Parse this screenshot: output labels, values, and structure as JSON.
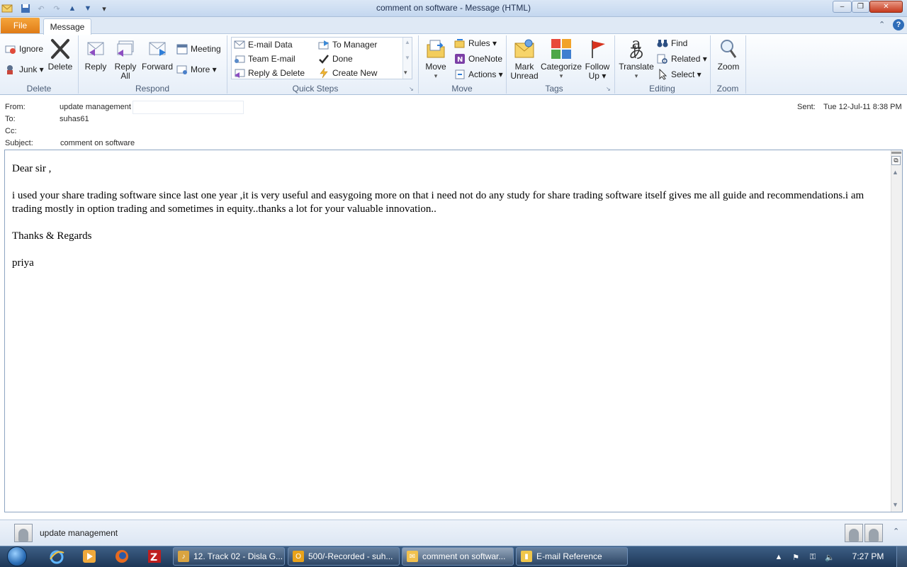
{
  "window": {
    "title": "comment on software - Message (HTML)",
    "controls": {
      "minimize": "–",
      "restore": "❐",
      "close": "✕"
    }
  },
  "quick_access": {
    "icons": [
      "outlook-icon",
      "save-icon",
      "undo-icon",
      "redo-icon",
      "previous-item-icon",
      "next-item-icon",
      "customize-icon"
    ]
  },
  "tabs": {
    "file": "File",
    "message": "Message"
  },
  "ribbon": {
    "delete_group": {
      "label": "Delete",
      "ignore": "Ignore",
      "junk": "Junk ▾",
      "delete": "Delete"
    },
    "respond_group": {
      "label": "Respond",
      "reply": "Reply",
      "reply_all_1": "Reply",
      "reply_all_2": "All",
      "forward": "Forward",
      "meeting": "Meeting",
      "more": "More ▾"
    },
    "quick_steps": {
      "label": "Quick Steps",
      "items": [
        "E-mail Data",
        "To Manager",
        "Team E-mail",
        "Done",
        "Reply & Delete",
        "Create New"
      ]
    },
    "move_group": {
      "label": "Move",
      "move": "Move",
      "rules": "Rules ▾",
      "onenote": "OneNote",
      "actions": "Actions ▾"
    },
    "tags_group": {
      "label": "Tags",
      "mark_unread_1": "Mark",
      "mark_unread_2": "Unread",
      "categorize": "Categorize",
      "follow_up_1": "Follow",
      "follow_up_2": "Up ▾"
    },
    "editing_group": {
      "label": "Editing",
      "translate": "Translate",
      "find": "Find",
      "related": "Related ▾",
      "select": "Select ▾"
    },
    "zoom_group": {
      "label": "Zoom",
      "zoom": "Zoom"
    }
  },
  "header": {
    "from_label": "From:",
    "from_value": "update management",
    "to_label": "To:",
    "to_value": "suhas61",
    "cc_label": "Cc:",
    "cc_value": "",
    "subject_label": "Subject:",
    "subject_value": "comment on software",
    "sent_label": "Sent:",
    "sent_value": "Tue 12-Jul-11 8:38 PM"
  },
  "message_body": {
    "greeting": "Dear sir ,",
    "paragraph": "i used your share trading software since last one year ,it is very useful and easygoing more on that i need not do any study for share trading software itself gives me all guide and recommendations.i am trading mostly in option trading and sometimes in equity..thanks a lot for your valuable innovation..",
    "closing": "Thanks & Regards",
    "signature": "priya"
  },
  "people_pane": {
    "name": "update management"
  },
  "taskbar": {
    "tasks": [
      {
        "label": "12. Track 02 - Disla G...",
        "icon": "winamp-icon",
        "color": "#d9a441"
      },
      {
        "label": "500/-Recorded - suh...",
        "icon": "outlook-icon",
        "color": "#e8a21a"
      },
      {
        "label": "comment on softwar...",
        "icon": "message-icon",
        "color": "#f2c14e"
      },
      {
        "label": "E-mail Reference",
        "icon": "folder-icon",
        "color": "#f0c64a"
      }
    ],
    "clock": "7:27 PM"
  },
  "colors": {
    "file_tab": "#e07b16",
    "taskbar": "#1d3656",
    "ribbon_label": "#4b5d77"
  }
}
